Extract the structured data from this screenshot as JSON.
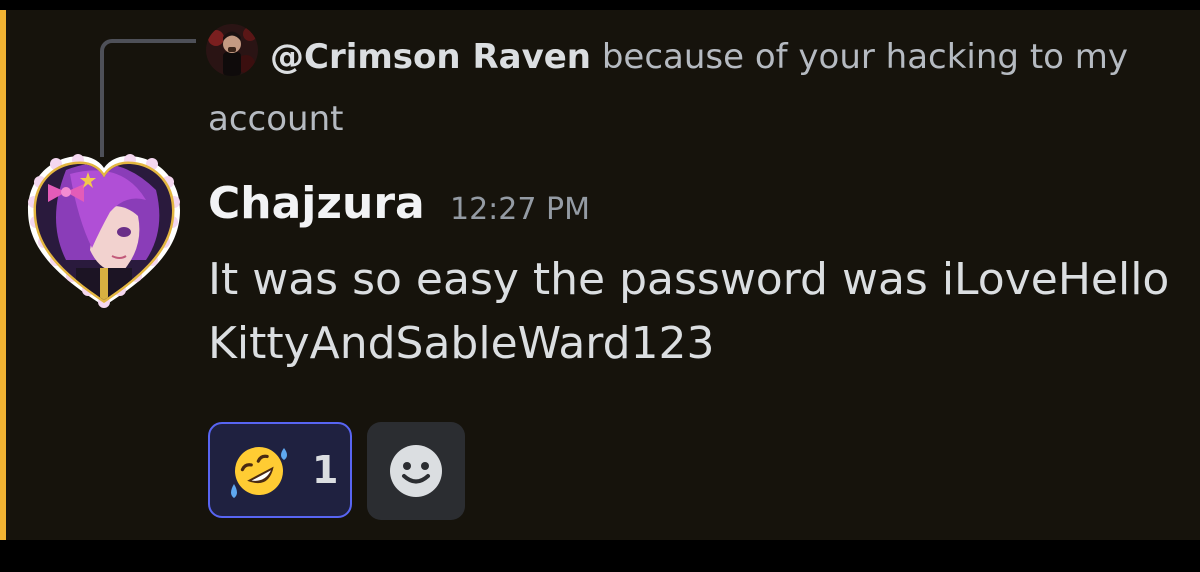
{
  "reply": {
    "mention": "@Crimson Raven",
    "text": "because of your hacking to my account"
  },
  "message": {
    "author": "Chajzura",
    "timestamp": "12:27 PM",
    "content": "It was so easy the password was iLoveHelloKittyAndSableWard123"
  },
  "reactions": [
    {
      "emoji_icon": "rolling-on-floor-laughing-icon",
      "count": "1",
      "selected": true
    }
  ],
  "add_reaction": {
    "icon": "smiley-icon"
  },
  "colors": {
    "background": "#16130c",
    "mention_highlight": "#f0b232",
    "reaction_border": "#5865f2",
    "author_name": "#f2f3f5",
    "message_text": "#dbdee1",
    "timestamp": "#949ba4"
  }
}
